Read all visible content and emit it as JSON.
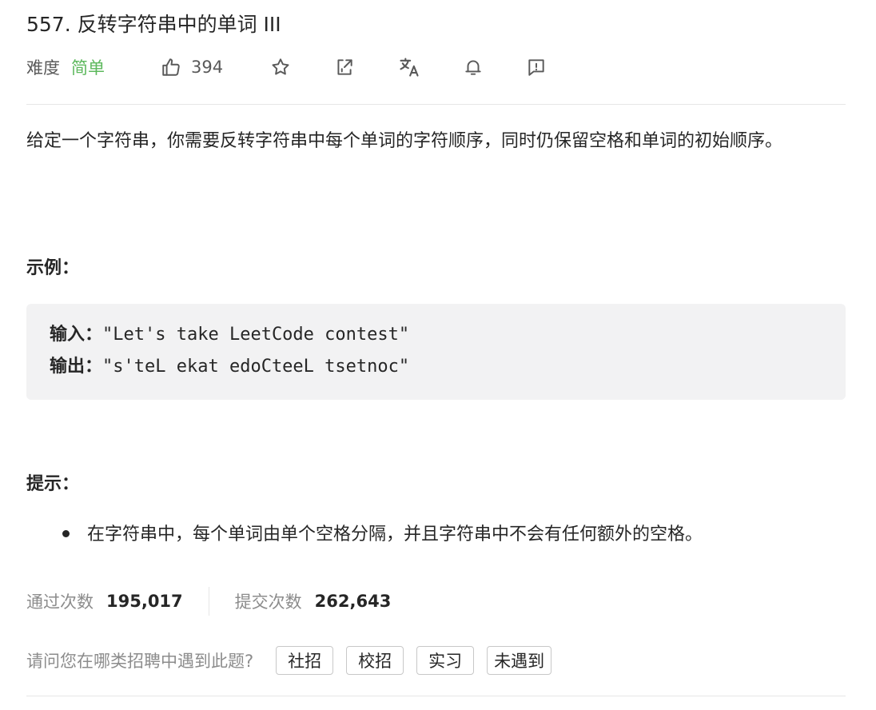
{
  "problem": {
    "title": "557. 反转字符串中的单词 III",
    "difficulty_label": "难度",
    "difficulty_value": "简单",
    "like_count": "394"
  },
  "description": "给定一个字符串，你需要反转字符串中每个单词的字符顺序，同时仍保留空格和单词的初始顺序。",
  "example": {
    "heading": "示例：",
    "input_label": "输入：",
    "input_value": "\"Let's take LeetCode contest\"",
    "output_label": "输出：",
    "output_value": "\"s'teL ekat edoCteeL tsetnoc\""
  },
  "hints": {
    "heading": "提示：",
    "items": [
      "在字符串中，每个单词由单个空格分隔，并且字符串中不会有任何额外的空格。"
    ]
  },
  "stats": {
    "accepted_label": "通过次数",
    "accepted_value": "195,017",
    "submitted_label": "提交次数",
    "submitted_value": "262,643"
  },
  "interview": {
    "question": "请问您在哪类招聘中遇到此题?",
    "options": [
      "社招",
      "校招",
      "实习",
      "未遇到"
    ]
  },
  "toolbar_icons": [
    "thumbs-up-icon",
    "star-icon",
    "share-icon",
    "translate-icon",
    "bell-icon",
    "feedback-icon"
  ],
  "colors": {
    "difficulty_easy": "#5cb85c",
    "muted_text": "#8c8c8c",
    "code_bg": "#f2f2f3"
  }
}
